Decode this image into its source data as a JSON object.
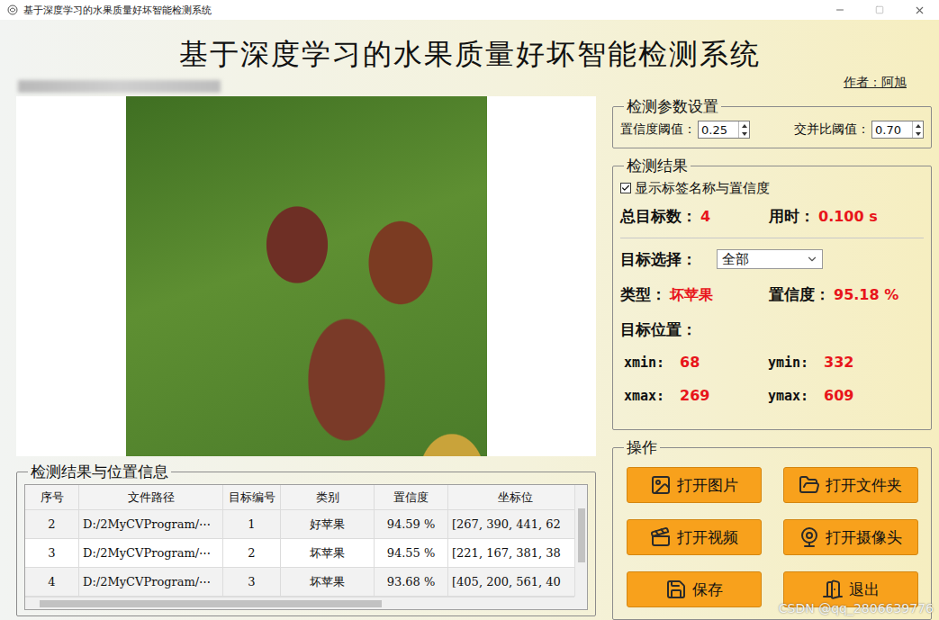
{
  "window": {
    "title": "基于深度学习的水果质量好坏智能检测系统"
  },
  "header": {
    "title": "基于深度学习的水果质量好坏智能检测系统",
    "author": "作者：阿旭"
  },
  "params": {
    "title": "检测参数设置",
    "fields": [
      {
        "label": "置信度阈值：",
        "value": "0.25"
      },
      {
        "label": "交并比阈值：",
        "value": "0.70"
      }
    ]
  },
  "results": {
    "title": "检测结果",
    "show_labels": {
      "label": "显示标签名称与置信度",
      "checked": true
    },
    "total": {
      "label": "总目标数：",
      "value": "4"
    },
    "time": {
      "label": "用时：",
      "value": "0.100 s"
    },
    "target_select": {
      "label": "目标选择：",
      "value": "全部"
    },
    "type": {
      "label": "类型：",
      "value": "坏苹果"
    },
    "confidence": {
      "label": "置信度：",
      "value": "95.18 %"
    },
    "position": {
      "label": "目标位置：",
      "coords": [
        {
          "label": "xmin:",
          "value": "68"
        },
        {
          "label": "ymin:",
          "value": "332"
        },
        {
          "label": "xmax:",
          "value": "269"
        },
        {
          "label": "ymax:",
          "value": "609"
        }
      ]
    }
  },
  "actions": {
    "title": "操作",
    "buttons": [
      "打开图片",
      "打开文件夹",
      "打开视频",
      "打开摄像头",
      "保存",
      "退出"
    ]
  },
  "table": {
    "title": "检测结果与位置信息",
    "columns": [
      "序号",
      "文件路径",
      "目标编号",
      "类别",
      "置信度",
      "坐标位"
    ],
    "rows": [
      [
        "2",
        "D:/2MyCVProgram/⋯",
        "1",
        "好苹果",
        "94.59 %",
        "[267, 390, 441, 62"
      ],
      [
        "3",
        "D:/2MyCVProgram/⋯",
        "2",
        "坏苹果",
        "94.55 %",
        "[221, 167, 381, 38"
      ],
      [
        "4",
        "D:/2MyCVProgram/⋯",
        "3",
        "坏苹果",
        "93.68 %",
        "[405, 200, 561, 40"
      ]
    ]
  },
  "watermark": "CSDN @qq_2806639776"
}
